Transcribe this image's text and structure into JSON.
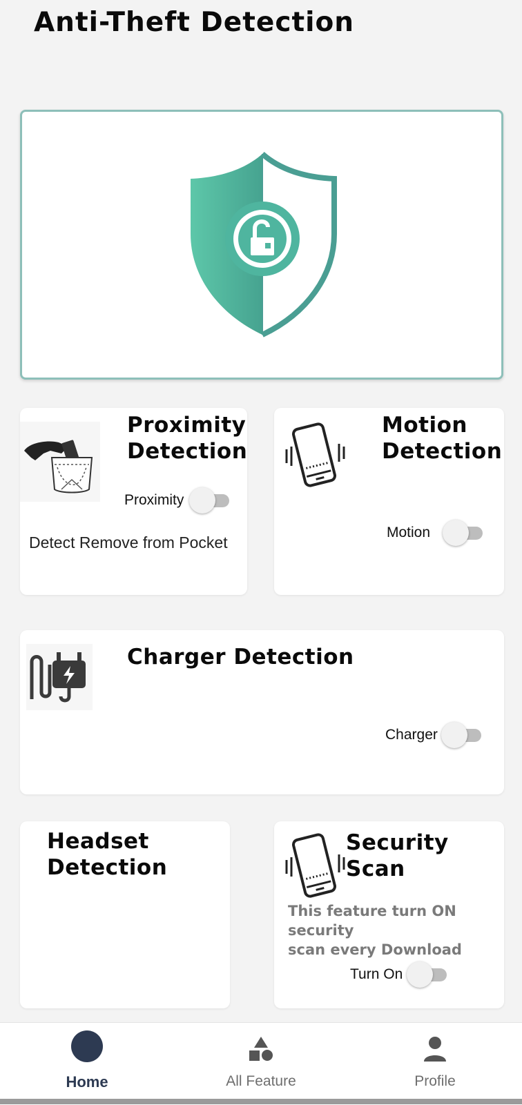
{
  "header": {
    "title": "Anti-Theft Detection"
  },
  "cards": {
    "proximity": {
      "title_line1": "Proximity",
      "title_line2": "Detection",
      "toggle_label": "Proximity",
      "toggle_on": false,
      "description": "Detect Remove from Pocket"
    },
    "motion": {
      "title_line1": "Motion",
      "title_line2": "Detection",
      "toggle_label": "Motion",
      "toggle_on": false
    },
    "charger": {
      "title": "Charger Detection",
      "toggle_label": "Charger",
      "toggle_on": false
    },
    "headset": {
      "title_line1": "Headset",
      "title_line2": "Detection"
    },
    "security_scan": {
      "title": "Security Scan",
      "description_line1": "This feature turn ON security",
      "description_line2": "scan every Download",
      "toggle_label": "Turn On",
      "toggle_on": false
    }
  },
  "bottom_nav": {
    "items": [
      {
        "label": "Home",
        "icon": "home-circle-icon",
        "active": true
      },
      {
        "label": "All Feature",
        "icon": "shapes-icon",
        "active": false
      },
      {
        "label": "Profile",
        "icon": "person-icon",
        "active": false
      }
    ]
  },
  "colors": {
    "accent_teal": "#4fb59f",
    "nav_active": "#2d3a52",
    "background": "#f3f3f3"
  }
}
